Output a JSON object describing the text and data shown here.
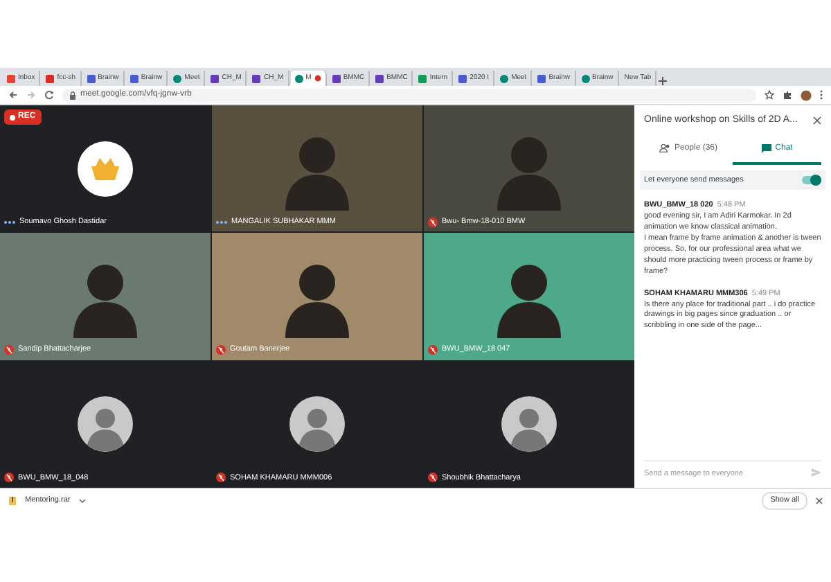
{
  "browser": {
    "tabs": [
      {
        "label": "Inbox",
        "kind": "mail",
        "selected": false
      },
      {
        "label": "fcc-sh",
        "kind": "pdf",
        "selected": false
      },
      {
        "label": "Brainw",
        "kind": "doc",
        "selected": false
      },
      {
        "label": "Brainw",
        "kind": "doc",
        "selected": false
      },
      {
        "label": "Meet",
        "kind": "meet",
        "selected": false
      },
      {
        "label": "CH_M",
        "kind": "form",
        "selected": false
      },
      {
        "label": "CH_M",
        "kind": "form",
        "selected": false
      },
      {
        "label": "M",
        "kind": "meet",
        "selected": true,
        "recording": true
      },
      {
        "label": "BMMC",
        "kind": "form",
        "selected": false
      },
      {
        "label": "BMMC",
        "kind": "form",
        "selected": false
      },
      {
        "label": "Intern",
        "kind": "sheet",
        "selected": false
      },
      {
        "label": "2020 I",
        "kind": "doc",
        "selected": false
      },
      {
        "label": "Meet",
        "kind": "meet",
        "selected": false
      },
      {
        "label": "Brainw",
        "kind": "doc",
        "selected": false
      },
      {
        "label": "Brainw",
        "kind": "meet",
        "selected": false
      },
      {
        "label": "New Tab",
        "kind": "blank",
        "selected": false
      }
    ],
    "url": "meet.google.com/vfq-jgnw-vrb"
  },
  "rec_badge": "REC",
  "tiles": [
    {
      "name": "Soumavo Ghosh Dastidar",
      "kind": "logo",
      "speaking": true
    },
    {
      "name": "MANGALIK SUBHAKAR MMM",
      "kind": "photo",
      "speaking": true
    },
    {
      "name": "Bwu- Bmw-18-010 BMW",
      "kind": "photo",
      "speaking": false
    },
    {
      "name": "Sandip Bhattacharjee",
      "kind": "photo",
      "speaking": false
    },
    {
      "name": "Goutam Banerjee",
      "kind": "photo",
      "speaking": false
    },
    {
      "name": "BWU_BMW_18 047",
      "kind": "photo",
      "speaking": false
    },
    {
      "name": "BWU_BMW_18_048",
      "kind": "avatar",
      "speaking": false
    },
    {
      "name": "SOHAM KHAMARU MMM006",
      "kind": "avatar",
      "speaking": false
    },
    {
      "name": "Shoubhik Bhattacharya",
      "kind": "avatar",
      "speaking": false
    }
  ],
  "panel": {
    "title": "Online workshop on Skills of 2D A...",
    "tabs": [
      {
        "label": "People (36)",
        "kind": "people",
        "selected": false
      },
      {
        "label": "Chat",
        "kind": "chat",
        "selected": true
      }
    ],
    "toggle": {
      "label": "Let everyone send messages",
      "on": true
    },
    "messages": [
      {
        "sender": "BWU_BMW_18 020",
        "time": "5:48 PM",
        "lines": [
          "good evening sir, I am Adiri Karmokar. In 2d animation we know classical animation.",
          "I mean frame by frame animation & another is tween process. So, for our professional area what we should more practicing tween process or frame by frame?"
        ]
      },
      {
        "sender": "SOHAM KHAMARU MMM306",
        "time": "5:49 PM",
        "lines": [
          "Is there any place for traditional part .. i do practice drawings in big pages since graduation .. or scribbling in one side of the page..."
        ]
      }
    ],
    "composer": {
      "placeholder": "Send a message to everyone"
    }
  },
  "downloads": {
    "file": "Mentoring.rar",
    "show_all": "Show all"
  }
}
